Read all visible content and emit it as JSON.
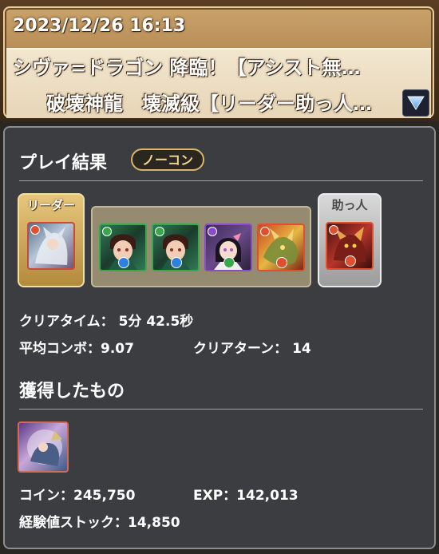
{
  "header": {
    "datetime": "2023/12/26 16:13",
    "title_line1": "シヴァ=ドラゴン 降臨！【アシスト無…",
    "title_line2": "破壊神龍　壊滅級【リーダー助っ人…"
  },
  "result": {
    "section_title": "プレイ結果",
    "badge": "ノーコン",
    "leader_label": "リーダー",
    "helper_label": "助っ人",
    "team": {
      "leader": {
        "attribute": "fire",
        "portrait": "white-haired-monster"
      },
      "members": [
        {
          "attribute": "wood",
          "sub_attribute": "water",
          "portrait": "tanjiro"
        },
        {
          "attribute": "wood",
          "sub_attribute": "water",
          "portrait": "tanjiro"
        },
        {
          "attribute": "dark",
          "sub_attribute": "wood",
          "portrait": "kanao"
        },
        {
          "attribute": "fire",
          "sub_attribute": "fire",
          "portrait": "dragon"
        }
      ],
      "helper": {
        "attribute": "fire",
        "sub_attribute": "fire",
        "portrait": "shiva-dragon"
      }
    },
    "clear_time": "クリアタイム： 5分 42.5秒",
    "avg_combo": "平均コンボ：9.07",
    "clear_turns": "クリアターン： 14"
  },
  "rewards": {
    "section_title": "獲得したもの",
    "item_icon": "monster-reward-icon",
    "coins": "コイン：245,750",
    "exp": "EXP：142,013",
    "exp_stock": "経験値ストック：14,850"
  },
  "colors": {
    "fire": "#e0502e",
    "water": "#2e7fe0",
    "wood": "#3aa84a",
    "dark": "#8a4cc9",
    "gold": "#d8b56a"
  }
}
